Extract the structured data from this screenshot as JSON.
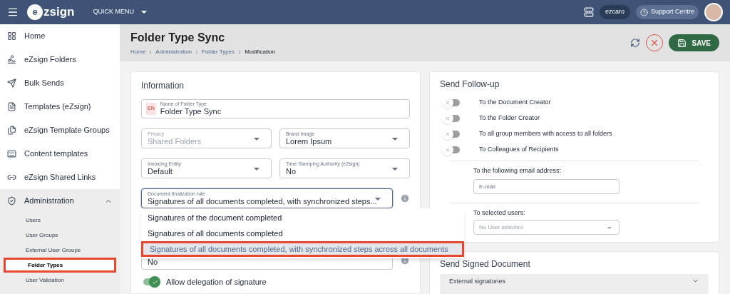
{
  "header": {
    "logo_mark": "e",
    "logo_text": "zsign",
    "quick_menu": "QUICK MENU",
    "user_chip": "ezcaro",
    "support": "Support Centre"
  },
  "sidebar": {
    "items": [
      {
        "label": "Home"
      },
      {
        "label": "eZsign Folders"
      },
      {
        "label": "Bulk Sends"
      },
      {
        "label": "Templates (eZsign)"
      },
      {
        "label": "eZsign Template Groups"
      },
      {
        "label": "Content templates"
      },
      {
        "label": "eZsign Shared Links"
      },
      {
        "label": "Administration",
        "expanded": true,
        "children": [
          {
            "label": "Users",
            "selected": false
          },
          {
            "label": "User Groups",
            "selected": false
          },
          {
            "label": "External User Groups",
            "selected": false
          },
          {
            "label": "Folder Types",
            "selected": true
          },
          {
            "label": "User Validation",
            "selected": false
          }
        ]
      }
    ]
  },
  "page": {
    "title": "Folder Type Sync",
    "breadcrumbs": [
      "Home",
      "Administration",
      "Folder Types",
      "Modification"
    ],
    "save": "SAVE"
  },
  "information": {
    "title": "Information",
    "name_field": {
      "lang": "EN",
      "label": "Name of Folder Type",
      "value": "Folder Type Sync"
    },
    "field_rows": [
      [
        {
          "label": "Privacy",
          "value": "Shared Folders",
          "disabled": true
        },
        {
          "label": "Brand Image",
          "value": "Lorem Ipsum",
          "disabled": false
        }
      ],
      [
        {
          "label": "Invoicing Entity",
          "value": "Default",
          "disabled": false
        },
        {
          "label": "Time Stamping Authority (eZsign)",
          "value": "No",
          "disabled": false
        }
      ]
    ],
    "finalization": {
      "label": "Document finalization rule",
      "value": "Signatures of all documents completed, with synchronized steps...",
      "expanded": true,
      "options": [
        {
          "label": "Signatures of the document completed",
          "selected": false
        },
        {
          "label": "Signatures of all documents completed",
          "selected": false
        },
        {
          "label": "Signatures of all documents completed, with synchronized steps across all documents",
          "selected": true
        }
      ]
    },
    "next_field": {
      "value": "No"
    },
    "delegation": {
      "label": "Allow delegation of signature",
      "on": true
    }
  },
  "follow_up": {
    "title": "Send Follow-up",
    "toggles": [
      {
        "label": "To the Document Creator",
        "on": false
      },
      {
        "label": "To the Folder Creator",
        "on": false
      },
      {
        "label": "To all group members with access to all folders",
        "on": false
      },
      {
        "label": "To Colleagues of Recipients",
        "on": false
      }
    ],
    "email": {
      "label": "To the following email address:",
      "placeholder": "E-mail"
    },
    "users": {
      "label": "To selected users:",
      "placeholder": "No User selected"
    }
  },
  "signed_document": {
    "title": "Send Signed Document",
    "section": "External signatories"
  }
}
